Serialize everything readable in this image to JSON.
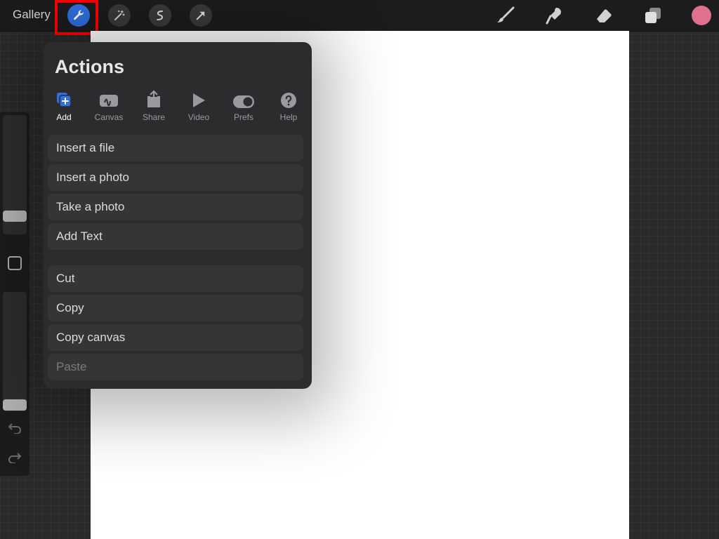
{
  "topbar": {
    "gallery_label": "Gallery",
    "tools_left": [
      "wrench-icon",
      "magic-wand-icon",
      "selection-icon",
      "transform-arrow-icon"
    ],
    "tools_right": [
      "brush-icon",
      "smudge-icon",
      "eraser-icon",
      "layers-icon"
    ],
    "current_color": "#e0708e",
    "accent_color": "#2f6fe0",
    "highlight_color": "#ff0000"
  },
  "actions_panel": {
    "title": "Actions",
    "tabs": [
      {
        "label": "Add",
        "icon": "add-icon",
        "active": true
      },
      {
        "label": "Canvas",
        "icon": "canvas-icon"
      },
      {
        "label": "Share",
        "icon": "share-icon"
      },
      {
        "label": "Video",
        "icon": "video-play-icon"
      },
      {
        "label": "Prefs",
        "icon": "toggle-icon"
      },
      {
        "label": "Help",
        "icon": "help-icon"
      }
    ],
    "group1": [
      "Insert a file",
      "Insert a photo",
      "Take a photo",
      "Add Text"
    ],
    "group2": [
      "Cut",
      "Copy",
      "Copy canvas",
      "Paste"
    ]
  }
}
